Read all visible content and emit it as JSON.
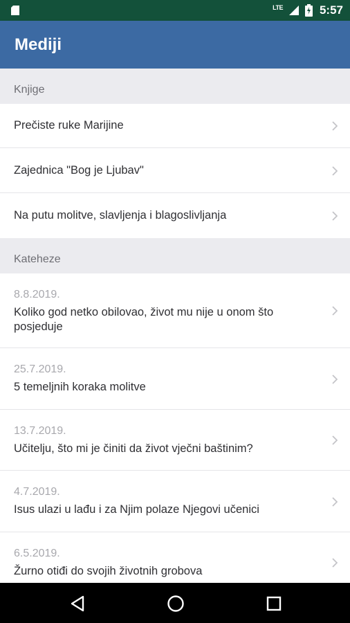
{
  "status_bar": {
    "network": "LTE",
    "time": "5:57"
  },
  "app_bar": {
    "title": "Mediji"
  },
  "sections": {
    "books": {
      "header": "Knjige",
      "items": [
        "Prečiste ruke Marijine",
        "Zajednica \"Bog je Ljubav\"",
        "Na putu molitve, slavljenja i blagoslivljanja"
      ]
    },
    "catecheses": {
      "header": "Kateheze",
      "items": [
        {
          "date": "8.8.2019.",
          "title": "Koliko god netko obilovao, život mu nije u onom što posjeduje"
        },
        {
          "date": "25.7.2019.",
          "title": "5 temeljnih koraka molitve"
        },
        {
          "date": "13.7.2019.",
          "title": "Učitelju, što mi je činiti da život vječni baštinim?"
        },
        {
          "date": "4.7.2019.",
          "title": "Isus ulazi u lađu i za Njim polaze Njegovi učenici"
        },
        {
          "date": "6.5.2019.",
          "title": "Žurno otiđi do svojih životnih grobova"
        }
      ]
    }
  },
  "icons": {
    "status": [
      "sd-card-icon",
      "lte-signal-icon",
      "battery-charging-icon"
    ],
    "navigation": [
      "back-icon",
      "home-icon",
      "recents-icon"
    ],
    "row": "chevron-right-icon"
  },
  "colors": {
    "status_bar": "#13513a",
    "app_bar": "#3c6aa3",
    "section_bg": "#ebebef"
  }
}
